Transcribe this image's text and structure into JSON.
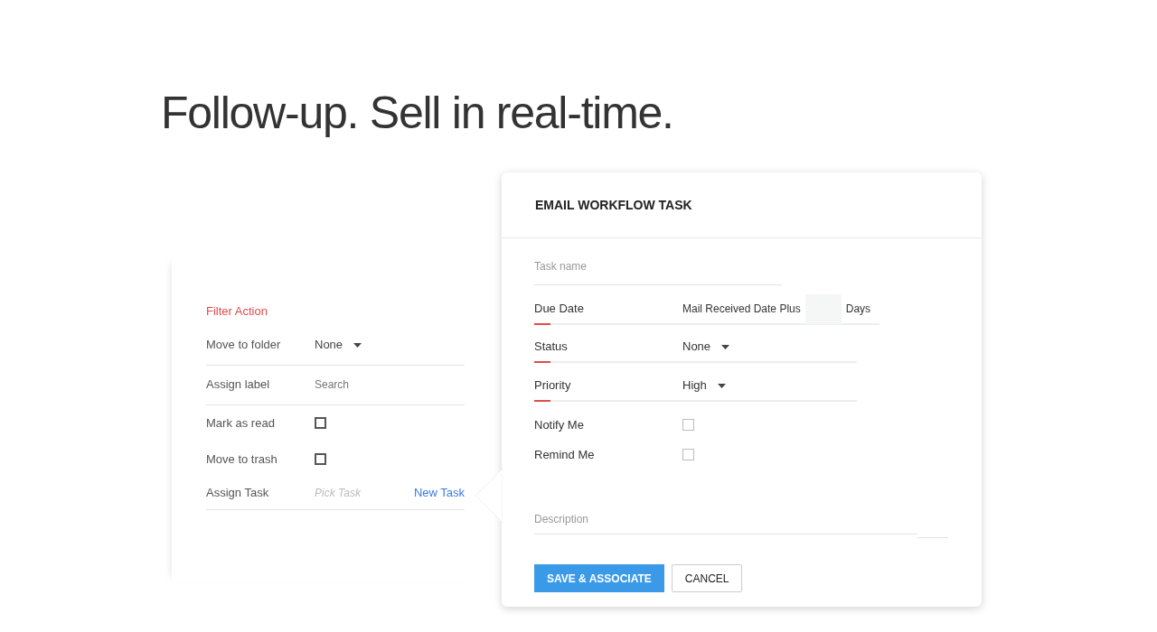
{
  "headline": "Follow-up. Sell in real-time.",
  "filter_panel": {
    "title": "Filter Action",
    "rows": [
      {
        "kind": "select",
        "label": "Move to folder",
        "value": "None"
      },
      {
        "kind": "search",
        "label": "Assign label",
        "placeholder": "Search"
      },
      {
        "kind": "checkbox",
        "label": "Mark as read",
        "checked": false
      },
      {
        "kind": "checkbox",
        "label": "Move to trash",
        "checked": false
      },
      {
        "kind": "task",
        "label": "Assign Task",
        "placeholder": "Pick Task",
        "link": "New Task"
      }
    ]
  },
  "dialog": {
    "title": "EMAIL WORKFLOW TASK",
    "fields": [
      {
        "kind": "text",
        "placeholder": "Task name",
        "required": false
      },
      {
        "kind": "due",
        "label": "Due Date",
        "value": "Mail Received Date Plus",
        "suffix": "Days",
        "required": true
      },
      {
        "kind": "select",
        "label": "Status",
        "value": "None",
        "required": true
      },
      {
        "kind": "select",
        "label": "Priority",
        "value": "High",
        "required": true
      },
      {
        "kind": "checkbox",
        "label": "Notify Me",
        "checked": false,
        "required": false
      },
      {
        "kind": "checkbox",
        "label": "Remind Me",
        "checked": false,
        "required": false
      },
      {
        "kind": "textarea",
        "placeholder": "Description",
        "required": false
      }
    ],
    "buttons": [
      {
        "kind": "primary",
        "label": "SAVE & ASSOCIATE"
      },
      {
        "kind": "secondary",
        "label": "CANCEL"
      }
    ]
  }
}
